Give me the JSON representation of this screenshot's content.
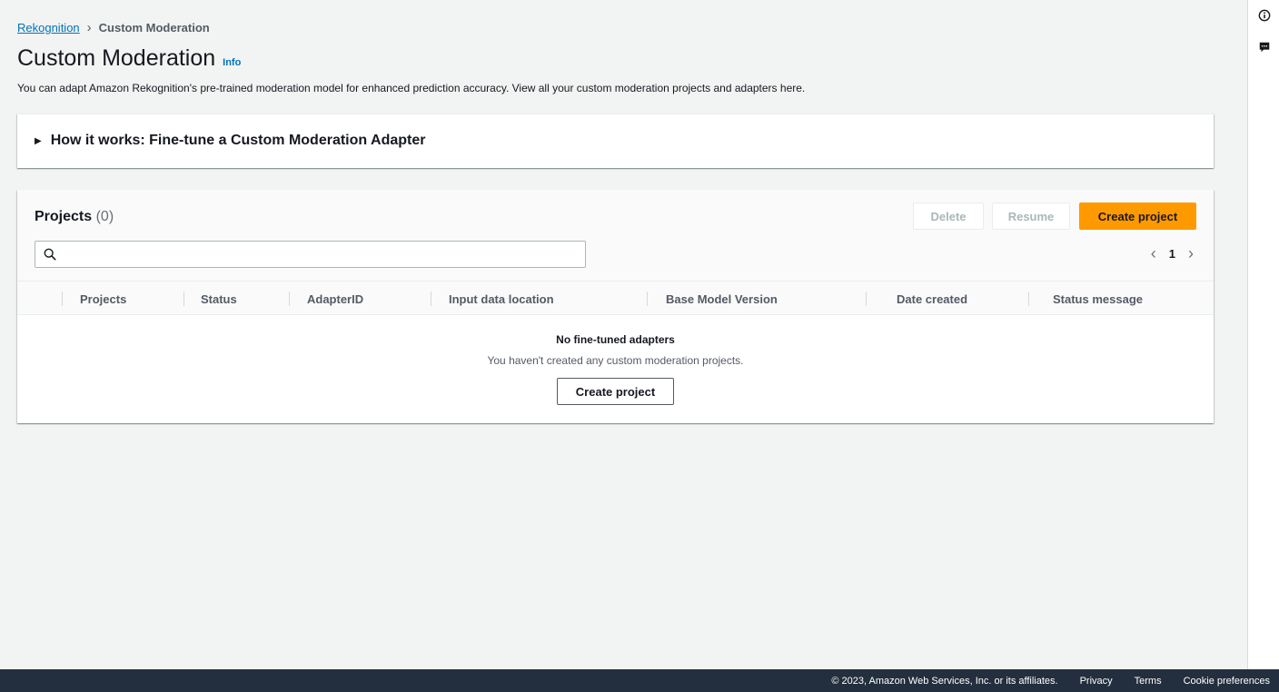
{
  "breadcrumb": {
    "items": [
      "Rekognition",
      "Custom Moderation"
    ]
  },
  "page": {
    "title": "Custom Moderation",
    "info": "Info",
    "description": "You can adapt Amazon Rekognition's pre-trained moderation model for enhanced prediction accuracy. View all your custom moderation projects and adapters here."
  },
  "how_it_works": {
    "label": "How it works: Fine-tune a Custom Moderation Adapter"
  },
  "projects": {
    "title": "Projects",
    "count": "(0)",
    "buttons": {
      "delete": "Delete",
      "resume": "Resume",
      "create": "Create project"
    },
    "search": {
      "value": "",
      "placeholder": ""
    },
    "pagination": {
      "current_page": "1"
    },
    "columns": [
      "Projects",
      "Status",
      "AdapterID",
      "Input data location",
      "Base Model Version",
      "Date created",
      "Status message"
    ],
    "empty": {
      "title": "No fine-tuned adapters",
      "description": "You haven't created any custom moderation projects.",
      "button": "Create project"
    }
  },
  "footer": {
    "copyright": "© 2023, Amazon Web Services, Inc. or its affiliates.",
    "links": [
      "Privacy",
      "Terms",
      "Cookie preferences"
    ]
  },
  "colors": {
    "primary_button": "#ff9900",
    "link": "#0073bb",
    "footer_bg": "#232f3e",
    "page_bg": "#f2f3f3"
  },
  "icons": {
    "rail": [
      "info-icon",
      "feedback-icon"
    ],
    "search": "search-icon",
    "pager": [
      "chevron-left-icon",
      "chevron-right-icon"
    ],
    "expand": "caret-right-icon"
  }
}
